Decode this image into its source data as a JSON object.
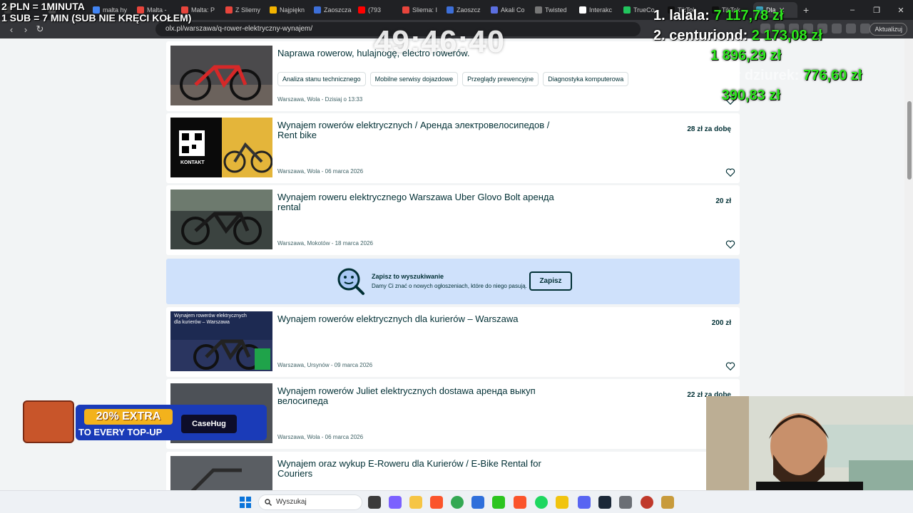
{
  "browser": {
    "tabs": [
      {
        "label": "",
        "color": "#3a3a3a"
      },
      {
        "label": "",
        "color": "#4a4a4a"
      },
      {
        "label": "malta hy",
        "color": "#4285f4"
      },
      {
        "label": "Malta -",
        "color": "#e8453c"
      },
      {
        "label": "Malta: P",
        "color": "#e8453c"
      },
      {
        "label": "Z Sliemy",
        "color": "#e8453c"
      },
      {
        "label": "Najpiękn",
        "color": "#f4b400"
      },
      {
        "label": "Zaoszcza",
        "color": "#3d6fd8"
      },
      {
        "label": "(793",
        "color": "#ff0000"
      },
      {
        "label": "Sliema: I",
        "color": "#e8453c"
      },
      {
        "label": "Zaoszcz",
        "color": "#3d6fd8"
      },
      {
        "label": "Akali Co",
        "color": "#5b6fe0"
      },
      {
        "label": "Twisted",
        "color": "#777777"
      },
      {
        "label": "Interakc",
        "color": "#ffffff"
      },
      {
        "label": "TrueCo",
        "color": "#22c55e"
      },
      {
        "label": "TikTok",
        "color": "#111111"
      },
      {
        "label": "TikTok",
        "color": "#111111"
      },
      {
        "label": "Dla",
        "color": "#3ba4c0",
        "active": true
      }
    ],
    "new_tab": "+",
    "window_controls": [
      "–",
      "❐",
      "✕"
    ],
    "url": "olx.pl/warszawa/q-rower-elektryczny-wynajem/",
    "update_label": "Aktualizuj"
  },
  "overlay": {
    "top_left_line1": "2 PLN =  1MINUTA",
    "top_left_line2": "1 SUB = 7 MIN (SUB NIE KRĘCI KOŁEM)",
    "timer": "49:46:40",
    "leaderboard": [
      {
        "name": "1. lalala:",
        "amount": "7 117,78 zł"
      },
      {
        "name": "2. centuriond:",
        "amount": "2 173,08 zł"
      },
      {
        "name": "3. alpik:",
        "amount": "1 896,29 zł"
      },
      {
        "name": "4. Penetrator dziurek:",
        "amount": "776,60 zł"
      },
      {
        "name": "5. Franio:",
        "amount": "390,83 zł"
      }
    ],
    "ad": {
      "line1": "20% EXTRA",
      "line2": "TO EVERY TOP-UP",
      "brand": "CaseHug"
    }
  },
  "listings": [
    {
      "title": "Naprawa rowerow, hulajnogę, electro rowerów.",
      "price": "",
      "meta": "Warszawa, Wola - Dzisiaj o 13:33",
      "chips": [
        "Analiza stanu technicznego",
        "Mobilne serwisy dojazdowe",
        "Przeglądy prewencyjne",
        "Diagnostyka komputerowa"
      ]
    },
    {
      "title": "Wynajem rowerów elektrycznych / Аренда электровелосипедов / Rent bike",
      "price": "28 zł za dobę",
      "meta": "Warszawa, Wola - 06 marca 2026"
    },
    {
      "title": "Wynajem roweru elektrycznego Warszawa Uber Glovo Bolt аренда rental",
      "price": "20 zł",
      "meta": "Warszawa, Mokotów - 18 marca 2026"
    },
    {
      "title": "Wynajem rowerów elektrycznych dla kurierów – Warszawa",
      "price": "200 zł",
      "meta": "Warszawa, Ursynów - 09 marca 2026",
      "thumb_text": "Wynajem rowerów elektrycznych dla kurierów – Warszawa"
    },
    {
      "title": "Wynajem rowerów Juliet elektrycznych dostawa аренда выкуп велосипеда",
      "price": "22 zł za dobę",
      "meta": "Warszawa, Wola - 06 marca 2026"
    },
    {
      "title": "Wynajem oraz wykup E-Roweru dla Kurierów / E-Bike Rental for Couriers",
      "price": "",
      "meta": ""
    }
  ],
  "save_search": {
    "title": "Zapisz to wyszukiwanie",
    "subtitle": "Damy Ci znać o nowych ogłoszeniach, które do niego pasują.",
    "button": "Zapisz"
  },
  "thumb2_label": "KONTAKT",
  "taskbar": {
    "search_placeholder": "Wyszukaj"
  },
  "colors": {
    "olx_text": "#002f34",
    "banner": "#cfe1fb",
    "accent_green": "#2ee81e"
  }
}
